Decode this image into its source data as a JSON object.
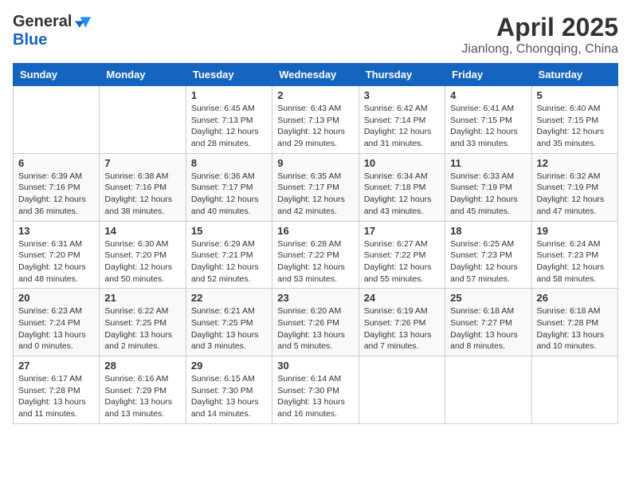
{
  "header": {
    "logo_general": "General",
    "logo_blue": "Blue",
    "month_title": "April 2025",
    "location": "Jianlong, Chongqing, China"
  },
  "weekdays": [
    "Sunday",
    "Monday",
    "Tuesday",
    "Wednesday",
    "Thursday",
    "Friday",
    "Saturday"
  ],
  "weeks": [
    [
      {
        "day": "",
        "sunrise": "",
        "sunset": "",
        "daylight": ""
      },
      {
        "day": "",
        "sunrise": "",
        "sunset": "",
        "daylight": ""
      },
      {
        "day": "1",
        "sunrise": "Sunrise: 6:45 AM",
        "sunset": "Sunset: 7:13 PM",
        "daylight": "Daylight: 12 hours and 28 minutes."
      },
      {
        "day": "2",
        "sunrise": "Sunrise: 6:43 AM",
        "sunset": "Sunset: 7:13 PM",
        "daylight": "Daylight: 12 hours and 29 minutes."
      },
      {
        "day": "3",
        "sunrise": "Sunrise: 6:42 AM",
        "sunset": "Sunset: 7:14 PM",
        "daylight": "Daylight: 12 hours and 31 minutes."
      },
      {
        "day": "4",
        "sunrise": "Sunrise: 6:41 AM",
        "sunset": "Sunset: 7:15 PM",
        "daylight": "Daylight: 12 hours and 33 minutes."
      },
      {
        "day": "5",
        "sunrise": "Sunrise: 6:40 AM",
        "sunset": "Sunset: 7:15 PM",
        "daylight": "Daylight: 12 hours and 35 minutes."
      }
    ],
    [
      {
        "day": "6",
        "sunrise": "Sunrise: 6:39 AM",
        "sunset": "Sunset: 7:16 PM",
        "daylight": "Daylight: 12 hours and 36 minutes."
      },
      {
        "day": "7",
        "sunrise": "Sunrise: 6:38 AM",
        "sunset": "Sunset: 7:16 PM",
        "daylight": "Daylight: 12 hours and 38 minutes."
      },
      {
        "day": "8",
        "sunrise": "Sunrise: 6:36 AM",
        "sunset": "Sunset: 7:17 PM",
        "daylight": "Daylight: 12 hours and 40 minutes."
      },
      {
        "day": "9",
        "sunrise": "Sunrise: 6:35 AM",
        "sunset": "Sunset: 7:17 PM",
        "daylight": "Daylight: 12 hours and 42 minutes."
      },
      {
        "day": "10",
        "sunrise": "Sunrise: 6:34 AM",
        "sunset": "Sunset: 7:18 PM",
        "daylight": "Daylight: 12 hours and 43 minutes."
      },
      {
        "day": "11",
        "sunrise": "Sunrise: 6:33 AM",
        "sunset": "Sunset: 7:19 PM",
        "daylight": "Daylight: 12 hours and 45 minutes."
      },
      {
        "day": "12",
        "sunrise": "Sunrise: 6:32 AM",
        "sunset": "Sunset: 7:19 PM",
        "daylight": "Daylight: 12 hours and 47 minutes."
      }
    ],
    [
      {
        "day": "13",
        "sunrise": "Sunrise: 6:31 AM",
        "sunset": "Sunset: 7:20 PM",
        "daylight": "Daylight: 12 hours and 48 minutes."
      },
      {
        "day": "14",
        "sunrise": "Sunrise: 6:30 AM",
        "sunset": "Sunset: 7:20 PM",
        "daylight": "Daylight: 12 hours and 50 minutes."
      },
      {
        "day": "15",
        "sunrise": "Sunrise: 6:29 AM",
        "sunset": "Sunset: 7:21 PM",
        "daylight": "Daylight: 12 hours and 52 minutes."
      },
      {
        "day": "16",
        "sunrise": "Sunrise: 6:28 AM",
        "sunset": "Sunset: 7:22 PM",
        "daylight": "Daylight: 12 hours and 53 minutes."
      },
      {
        "day": "17",
        "sunrise": "Sunrise: 6:27 AM",
        "sunset": "Sunset: 7:22 PM",
        "daylight": "Daylight: 12 hours and 55 minutes."
      },
      {
        "day": "18",
        "sunrise": "Sunrise: 6:25 AM",
        "sunset": "Sunset: 7:23 PM",
        "daylight": "Daylight: 12 hours and 57 minutes."
      },
      {
        "day": "19",
        "sunrise": "Sunrise: 6:24 AM",
        "sunset": "Sunset: 7:23 PM",
        "daylight": "Daylight: 12 hours and 58 minutes."
      }
    ],
    [
      {
        "day": "20",
        "sunrise": "Sunrise: 6:23 AM",
        "sunset": "Sunset: 7:24 PM",
        "daylight": "Daylight: 13 hours and 0 minutes."
      },
      {
        "day": "21",
        "sunrise": "Sunrise: 6:22 AM",
        "sunset": "Sunset: 7:25 PM",
        "daylight": "Daylight: 13 hours and 2 minutes."
      },
      {
        "day": "22",
        "sunrise": "Sunrise: 6:21 AM",
        "sunset": "Sunset: 7:25 PM",
        "daylight": "Daylight: 13 hours and 3 minutes."
      },
      {
        "day": "23",
        "sunrise": "Sunrise: 6:20 AM",
        "sunset": "Sunset: 7:26 PM",
        "daylight": "Daylight: 13 hours and 5 minutes."
      },
      {
        "day": "24",
        "sunrise": "Sunrise: 6:19 AM",
        "sunset": "Sunset: 7:26 PM",
        "daylight": "Daylight: 13 hours and 7 minutes."
      },
      {
        "day": "25",
        "sunrise": "Sunrise: 6:18 AM",
        "sunset": "Sunset: 7:27 PM",
        "daylight": "Daylight: 13 hours and 8 minutes."
      },
      {
        "day": "26",
        "sunrise": "Sunrise: 6:18 AM",
        "sunset": "Sunset: 7:28 PM",
        "daylight": "Daylight: 13 hours and 10 minutes."
      }
    ],
    [
      {
        "day": "27",
        "sunrise": "Sunrise: 6:17 AM",
        "sunset": "Sunset: 7:28 PM",
        "daylight": "Daylight: 13 hours and 11 minutes."
      },
      {
        "day": "28",
        "sunrise": "Sunrise: 6:16 AM",
        "sunset": "Sunset: 7:29 PM",
        "daylight": "Daylight: 13 hours and 13 minutes."
      },
      {
        "day": "29",
        "sunrise": "Sunrise: 6:15 AM",
        "sunset": "Sunset: 7:30 PM",
        "daylight": "Daylight: 13 hours and 14 minutes."
      },
      {
        "day": "30",
        "sunrise": "Sunrise: 6:14 AM",
        "sunset": "Sunset: 7:30 PM",
        "daylight": "Daylight: 13 hours and 16 minutes."
      },
      {
        "day": "",
        "sunrise": "",
        "sunset": "",
        "daylight": ""
      },
      {
        "day": "",
        "sunrise": "",
        "sunset": "",
        "daylight": ""
      },
      {
        "day": "",
        "sunrise": "",
        "sunset": "",
        "daylight": ""
      }
    ]
  ]
}
